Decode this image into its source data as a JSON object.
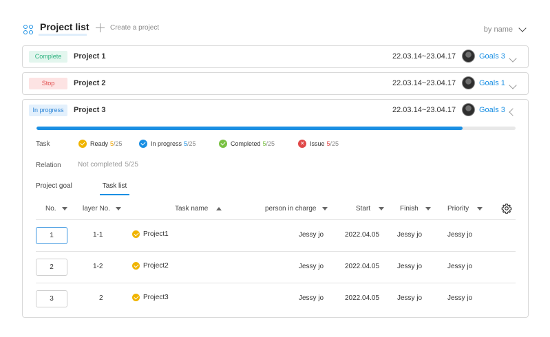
{
  "header": {
    "title": "Project list",
    "create_label": "Create a project",
    "sort_label": "by name"
  },
  "projects": [
    {
      "status": "Complete",
      "name": "Project 1",
      "dates": "22.03.14~23.04.17",
      "goals": "Goals 3"
    },
    {
      "status": "Stop",
      "name": "Project 2",
      "dates": "22.03.14~23.04.17",
      "goals": "Goals 1"
    },
    {
      "status": "In progress",
      "name": "Project 3",
      "dates": "22.03.14~23.04.17",
      "goals": "Goals 3"
    }
  ],
  "detail": {
    "progress_fraction": 0.89,
    "task_label": "Task",
    "statuses": [
      {
        "label": "Ready",
        "done": "5",
        "total": "/25",
        "color": "#f0b400"
      },
      {
        "label": "In progress",
        "done": "5",
        "total": "/25",
        "color": "#1a8fe3"
      },
      {
        "label": "Completed",
        "done": "5",
        "total": "/25",
        "color": "#7ac143"
      },
      {
        "label": "Issue",
        "done": "5",
        "total": "/25",
        "color": "#e04848"
      }
    ],
    "relation_label": "Relation",
    "relation_value": "Not completed",
    "relation_count": "5/25",
    "subtabs": [
      "Project goal",
      "Task list"
    ],
    "columns": [
      "No.",
      "layer No.",
      "Task name",
      "person in charge",
      "Start",
      "Finish",
      "Priority"
    ],
    "rows": [
      {
        "no": "1",
        "layer": "1-1",
        "task": "Project1",
        "person": "Jessy jo",
        "start": "2022.04.05",
        "finish": "Jessy jo",
        "priority": "Jessy jo"
      },
      {
        "no": "2",
        "layer": "1-2",
        "task": "Project2",
        "person": "Jessy jo",
        "start": "2022.04.05",
        "finish": "Jessy jo",
        "priority": "Jessy jo"
      },
      {
        "no": "3",
        "layer": "2",
        "task": "Project3",
        "person": "Jessy jo",
        "start": "2022.04.05",
        "finish": "Jessy jo",
        "priority": "Jessy jo"
      }
    ]
  },
  "colors": {
    "accent": "#1a8fe3",
    "complete": "#2bb17e",
    "stop": "#e04848"
  }
}
